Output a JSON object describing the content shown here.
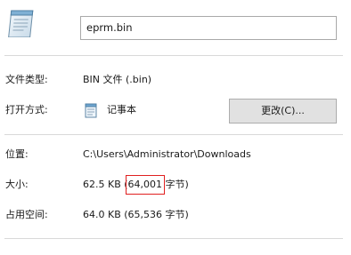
{
  "file": {
    "icon": "notepad-document-icon",
    "name": "eprm.bin"
  },
  "properties": {
    "type_label": "文件类型:",
    "type_value": "BIN 文件 (.bin)",
    "opens_with_label": "打开方式:",
    "opens_with_app_icon": "notepad-icon",
    "opens_with_app": "记事本",
    "change_button": "更改(C)...",
    "location_label": "位置:",
    "location_value": "C:\\Users\\Administrator\\Downloads",
    "size_label": "大小:",
    "size_value_main": "62.5 KB (",
    "size_value_bytes": "64,001",
    "size_value_unit": " 字节)",
    "size_on_disk_label": "占用空间:",
    "size_on_disk_value": "64.0 KB (65,536 字节)"
  },
  "colors": {
    "highlight": "#e02020",
    "separator": "#d9d9d9",
    "button_bg": "#e1e1e1"
  }
}
